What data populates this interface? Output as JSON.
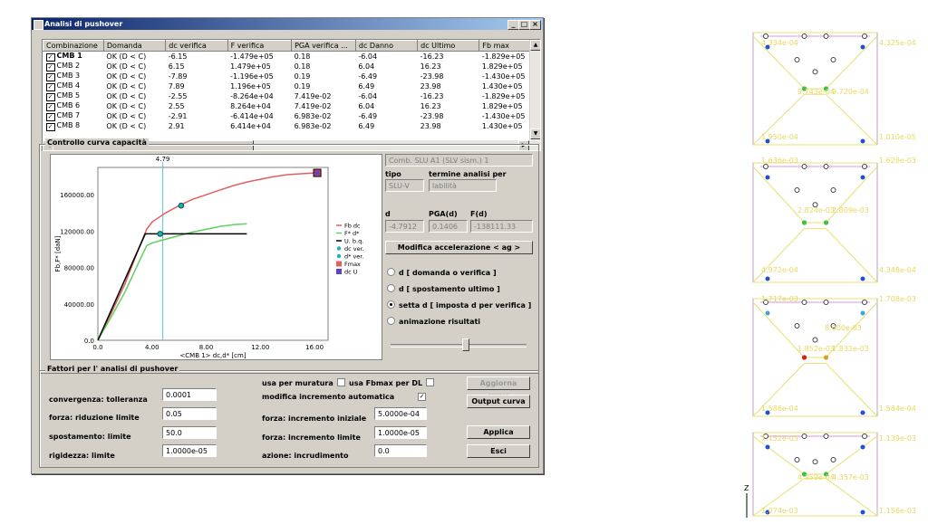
{
  "window": {
    "title": "Analisi di pushover"
  },
  "table": {
    "columns": [
      "Combinazione",
      "Domanda",
      "dc verifica",
      "F verifica",
      "PGA verifica ...",
      "dc Danno",
      "dc Ultimo",
      "Fb max"
    ],
    "rows": [
      [
        "CMB 1",
        "OK (D < C)",
        "-6.15",
        "-1.479e+05",
        "0.18",
        "-6.04",
        "-16.23",
        "-1.829e+05"
      ],
      [
        "CMB 2",
        "OK (D < C)",
        "6.15",
        "1.479e+05",
        "0.18",
        "6.04",
        "16.23",
        "1.829e+05"
      ],
      [
        "CMB 3",
        "OK (D < C)",
        "-7.89",
        "-1.196e+05",
        "0.19",
        "-6.49",
        "-23.98",
        "-1.430e+05"
      ],
      [
        "CMB 4",
        "OK (D < C)",
        "7.89",
        "1.196e+05",
        "0.19",
        "6.49",
        "23.98",
        "1.430e+05"
      ],
      [
        "CMB 5",
        "OK (D < C)",
        "-2.55",
        "-8.264e+04",
        "7.419e-02",
        "-6.04",
        "-16.23",
        "-1.829e+05"
      ],
      [
        "CMB 6",
        "OK (D < C)",
        "2.55",
        "8.264e+04",
        "7.419e-02",
        "6.04",
        "16.23",
        "1.829e+05"
      ],
      [
        "CMB 7",
        "OK (D < C)",
        "-2.91",
        "-6.414e+04",
        "6.983e-02",
        "-6.49",
        "-23.98",
        "-1.430e+05"
      ],
      [
        "CMB 8",
        "OK (D < C)",
        "2.91",
        "6.414e+04",
        "6.983e-02",
        "6.49",
        "23.98",
        "1.430e+05"
      ]
    ]
  },
  "curve_group": {
    "label": "Controllo curva capacità"
  },
  "chart_data": {
    "type": "line",
    "xlabel": "<CMB 1> dc,d* [cm]",
    "ylabel": "Fb,F* [daN]",
    "xlim": [
      0,
      17
    ],
    "ylim": [
      0,
      190000
    ],
    "xticks": [
      "0.0",
      "4.00",
      "8.00",
      "12.00",
      "16.00"
    ],
    "yticks": [
      "0.0",
      "40000.00",
      "80000.00",
      "120000.00",
      "160000.00"
    ],
    "marker_label": "4.79",
    "marker_x": 4.79,
    "series": [
      {
        "name": "Fb dc",
        "color": "#e06060",
        "x": [
          0,
          1,
          2,
          3,
          3.6,
          4,
          5,
          6,
          7,
          8,
          9,
          10,
          11,
          12,
          13,
          14,
          15,
          16.2
        ],
        "y": [
          0,
          30000,
          62000,
          100000,
          122000,
          130000,
          140000,
          148000,
          155000,
          160000,
          165000,
          170000,
          174000,
          177000,
          180000,
          182000,
          183000,
          184000
        ]
      },
      {
        "name": "F* d*",
        "color": "#60d060",
        "x": [
          0,
          1,
          2,
          3,
          3.6,
          4,
          5,
          6,
          7,
          8,
          9,
          10,
          11
        ],
        "y": [
          0,
          26000,
          53000,
          85000,
          104000,
          107000,
          111000,
          115000,
          119000,
          122000,
          125000,
          127000,
          128000
        ]
      },
      {
        "name": "U. b.q.",
        "color": "#000000",
        "x": [
          0,
          3.5,
          11
        ],
        "y": [
          0,
          117000,
          117000
        ]
      }
    ],
    "points": [
      {
        "name": "dc ver.",
        "x": 6.15,
        "y": 148000,
        "color": "#20b0b0"
      },
      {
        "name": "d* ver.",
        "x": 4.6,
        "y": 117000,
        "color": "#20b0b0"
      },
      {
        "name": "Fmax",
        "x": 16.2,
        "y": 184000,
        "color": "#e04040"
      },
      {
        "name": "dc U",
        "x": 16.2,
        "y": 184000,
        "color": "#6040d0"
      }
    ],
    "legend": [
      "Fb dc",
      "F* d*",
      "U. b.q.",
      "dc ver.",
      "d* ver.",
      "Fmax",
      "dc U"
    ]
  },
  "side": {
    "comb": "Comb. SLU A1 (SLV sism.) 1",
    "tipo_label": "tipo",
    "termine_label": "termine analisi per",
    "tipo_value": "SLU-V",
    "termine_value": "labilità",
    "d_label": "d",
    "pga_label": "PGA(d)",
    "f_label": "F(d)",
    "d_value": "-4.7912",
    "pga_value": "0.1406",
    "f_value": "-138111.33",
    "modifica_btn": "Modifica accelerazione  < ag >",
    "radios": [
      "d [ domanda o verifica ]",
      "d [ spostamento ultimo ]",
      "setta d [ imposta d per verifica ]",
      "animazione risultati"
    ],
    "slider_value": 0.55
  },
  "params": {
    "label": "Fattori per l' analisi di pushover",
    "convergenza_label": "convergenza: tolleranza",
    "convergenza_value": "0.0001",
    "forza_rid_label": "forza: riduzione limite",
    "forza_rid_value": "0.05",
    "spost_label": "spostamento: limite",
    "spost_value": "50.0",
    "rigid_label": "rigidezza: limite",
    "rigid_value": "1.0000e-05",
    "muratura_label": "usa per muratura",
    "fbmax_label": "usa Fbmax per DL",
    "modifica_label": "modifica incremento automatica",
    "incr_ini_label": "forza: incremento iniziale",
    "incr_ini_value": "5.0000e-04",
    "incr_lim_label": "forza: incremento limite",
    "incr_lim_value": "1.0000e-05",
    "azione_label": "azione: incrudimento",
    "azione_value": "0.0",
    "btn_aggiorna": "Aggiorna curve",
    "btn_output": "Output curva",
    "btn_applica": "Applica",
    "btn_esci": "Esci"
  },
  "structure": {
    "labels": [
      "4.334e-04",
      "4.325e-04",
      "9.743e-04",
      "9.720e-04",
      "1.950e-04",
      "1.010e-05",
      "1.636e-03",
      "1.628e-03",
      "2.824e-03",
      "2.809e-03",
      "4.972e-04",
      "4.348e-04",
      "1.717e-03",
      "1.708e-03",
      "8.000e-03",
      "1.852e-03",
      "1.832e-03",
      "1.586e-04",
      "1.584e-04",
      "1.152e-03",
      "1.139e-03",
      "4.359e-04",
      "4.357e-03",
      "1.074e-03",
      "1.156e-03"
    ],
    "axis_label": "Z"
  }
}
